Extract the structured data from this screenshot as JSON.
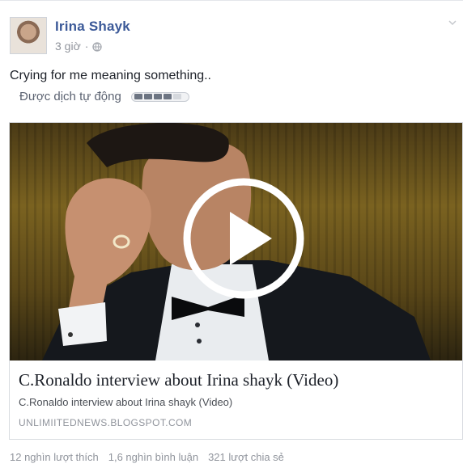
{
  "post": {
    "author": "Irina Shayk",
    "time": "3 giờ",
    "separator": "·",
    "privacy_icon": "globe-icon",
    "text": "Crying for me meaning something..",
    "translation": {
      "label": "Được dịch tự động",
      "rating_filled": 4,
      "rating_total": 5
    }
  },
  "link_card": {
    "media_type": "video",
    "play_icon": "play-icon",
    "title": "C.Ronaldo interview about Irina shayk (Video)",
    "description": "C.Ronaldo interview about Irina shayk (Video)",
    "domain": "UNLIMIITEDNEWS.BLOGSPOT.COM"
  },
  "stats": {
    "likes": "12 nghìn lượt thích",
    "comments": "1,6 nghìn bình luận",
    "shares": "321 lượt chia sẻ"
  },
  "colors": {
    "author_link": "#3b5998",
    "meta_gray": "#90949c",
    "text": "#1d2129"
  }
}
